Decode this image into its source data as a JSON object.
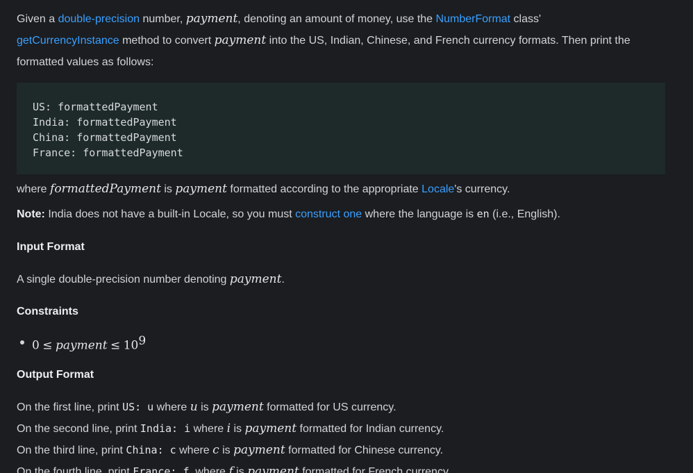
{
  "intro": {
    "t1": "Given a ",
    "link_double": "double-precision",
    "t2": " number, ",
    "var_payment": "payment",
    "t3": ", denoting an amount of money, use the ",
    "link_numberformat": "NumberFormat",
    "t4": " class'",
    "link_getcurrency": "getCurrencyInstance",
    "t5": " method to convert ",
    "t6": " into the US, Indian, Chinese, and French currency formats. Then print the formatted values as follows:"
  },
  "code": {
    "lines": [
      "US: formattedPayment",
      "India: formattedPayment",
      "China: formattedPayment",
      "France: formattedPayment"
    ]
  },
  "where": {
    "t1": "where ",
    "var_formatted": "formattedPayment",
    "t2": " is ",
    "var_payment": "payment",
    "t3": " formatted according to the appropriate ",
    "link_locale": "Locale",
    "t4": "'s currency."
  },
  "note": {
    "label": "Note:",
    "t1": " India does not have a built-in Locale, so you must ",
    "link_construct": "construct one",
    "t2": " where the language is ",
    "code_en": "en",
    "t3": " (i.e., English)."
  },
  "input_format": {
    "heading": "Input Format",
    "t1": "A single double-precision number denoting ",
    "var_payment": "payment",
    "t2": "."
  },
  "constraints": {
    "heading": "Constraints",
    "zero": "0",
    "le1": "≤",
    "var_payment": "payment",
    "le2": "≤",
    "base": "10",
    "exp": "9"
  },
  "output_format": {
    "heading": "Output Format",
    "lines": [
      {
        "pre": "On the first line, print ",
        "code": "US: u",
        "mid": " where ",
        "var": "u",
        "is": " is ",
        "payment": "payment",
        "post": " formatted for US currency."
      },
      {
        "pre": "On the second line, print ",
        "code": "India: i",
        "mid": " where ",
        "var": "i",
        "is": " is ",
        "payment": "payment",
        "post": " formatted for Indian currency."
      },
      {
        "pre": "On the third line, print ",
        "code": "China: c",
        "mid": " where ",
        "var": "c",
        "is": " is ",
        "payment": "payment",
        "post": " formatted for Chinese currency."
      },
      {
        "pre": "On the fourth line, print ",
        "code": "France: f",
        "mid": ", where ",
        "var": "f",
        "is": " is ",
        "payment": "payment",
        "post": " formatted for French currency."
      }
    ]
  },
  "colors": {
    "background": "#1b1d21",
    "link": "#3aa0ff",
    "code_block_bg": "#1e2a2a",
    "text": "#d2d4d8"
  }
}
